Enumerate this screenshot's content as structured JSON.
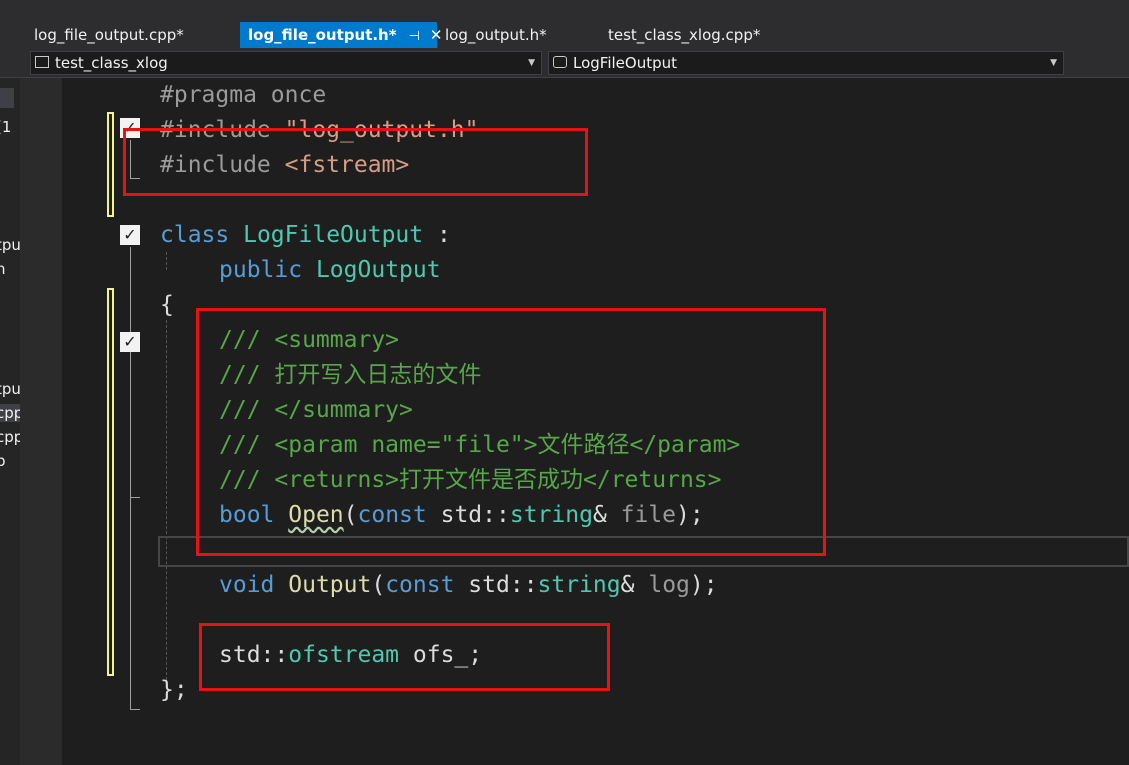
{
  "tabs": [
    {
      "label": "log_file_output.cpp*"
    },
    {
      "label": "log_file_output.h*",
      "active": true
    },
    {
      "label": "log_output.h*"
    },
    {
      "label": "test_class_xlog.cpp*"
    }
  ],
  "tab_pin_glyph": "⊣",
  "tab_close_glyph": "✕",
  "left_close_glyph": "✕",
  "nav": {
    "scope": "test_class_xlog",
    "member": "LogFileOutput"
  },
  "left_panel": {
    "items": [
      "(1",
      "tpu",
      "h",
      "tpu",
      "cpp",
      "cpp",
      "p"
    ]
  },
  "code": {
    "line1": {
      "directive": "#pragma once"
    },
    "line2": {
      "directive": "#include ",
      "path": "\"log_output.h\""
    },
    "line3": {
      "directive": "#include ",
      "path": "<fstream>"
    },
    "line4": {
      "kw": "class",
      "name": "LogFileOutput",
      "rest": " :"
    },
    "line5": {
      "kw": "public",
      "base": "LogOutput"
    },
    "line6": {
      "text": "{"
    },
    "line7": {
      "comment": "/// <summary>"
    },
    "line8": {
      "comment": "/// 打开写入日志的文件"
    },
    "line9": {
      "comment": "/// </summary>"
    },
    "line10": {
      "comment": "/// <param name=\"file\">文件路径</param>"
    },
    "line11": {
      "comment": "/// <returns>打开文件是否成功</returns>"
    },
    "line12": {
      "type": "bool",
      "fn": "Open",
      "p1": "(",
      "kw": "const",
      "ns": " std::",
      "ty": "string",
      "amp": "& ",
      "param": "file",
      "end": ");"
    },
    "line14": {
      "type": "void",
      "fn": "Output",
      "p1": "(",
      "kw": "const",
      "ns": " std::",
      "ty": "string",
      "amp": "& ",
      "param": "log",
      "end": ");"
    },
    "line16": {
      "ns": "std::",
      "ty": "ofstream",
      "rest": " ofs_;"
    },
    "line17": {
      "text": "};"
    }
  },
  "colors": {
    "keyword": "#569cd6",
    "type": "#4ec9b0",
    "function": "#dcdcaa",
    "string": "#d69d85",
    "comment": "#57a64a",
    "highlight_box": "#e51313",
    "active_tab": "#007acc"
  }
}
